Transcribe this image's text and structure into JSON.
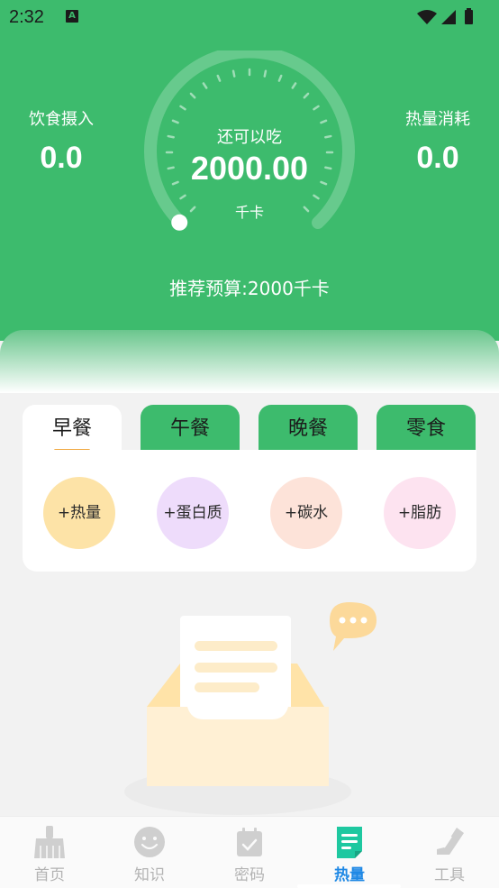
{
  "status_bar": {
    "time": "2:32",
    "notification_letter": "A",
    "icons": [
      "wifi-icon",
      "signal-icon",
      "battery-icon"
    ]
  },
  "header": {
    "intake": {
      "label": "饮食摄入",
      "value": "0.0"
    },
    "burned": {
      "label": "热量消耗",
      "value": "0.0"
    },
    "gauge": {
      "label": "还可以吃",
      "value": "2000.00",
      "unit": "千卡",
      "remaining_fraction": 1.0
    },
    "budget_text": "推荐预算:2000千卡"
  },
  "meal_tabs": [
    {
      "label": "早餐",
      "active": true
    },
    {
      "label": "午餐",
      "active": false
    },
    {
      "label": "晚餐",
      "active": false
    },
    {
      "label": "零食",
      "active": false
    }
  ],
  "nutrients": [
    {
      "label": "+热量",
      "color": "#fde3a7"
    },
    {
      "label": "+蛋白质",
      "color": "#eedcfb"
    },
    {
      "label": "+碳水",
      "color": "#fde3d9"
    },
    {
      "label": "+脂肪",
      "color": "#fde3f0"
    }
  ],
  "bottom_nav": [
    {
      "label": "首页",
      "icon": "broom-icon",
      "active": false
    },
    {
      "label": "知识",
      "icon": "smiley-icon",
      "active": false
    },
    {
      "label": "密码",
      "icon": "calendar-check-icon",
      "active": false
    },
    {
      "label": "热量",
      "icon": "document-icon",
      "active": true
    },
    {
      "label": "工具",
      "icon": "sneaker-icon",
      "active": false
    }
  ],
  "colors": {
    "brand_green": "#3dbb6d",
    "accent_orange": "#f0a840",
    "active_nav_blue": "#1e88e5",
    "active_nav_icon_teal": "#1ec8a0"
  }
}
